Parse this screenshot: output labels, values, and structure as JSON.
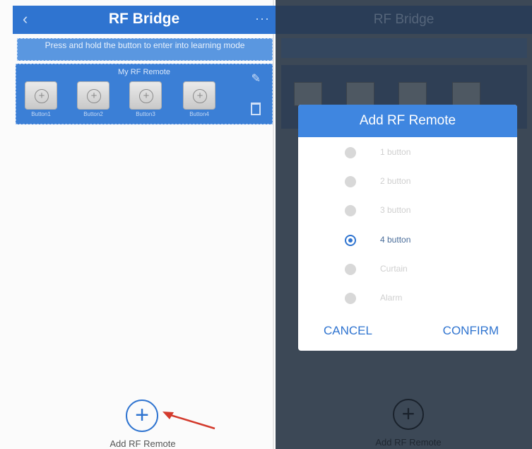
{
  "left": {
    "header": {
      "title": "RF Bridge",
      "back_glyph": "‹",
      "more_glyph": "···"
    },
    "banner": "Press and hold the button to enter into learning mode",
    "card": {
      "title": "My RF Remote",
      "buttons": [
        "Button1",
        "Button2",
        "Button3",
        "Button4"
      ],
      "edit_icon": "pencil-icon",
      "delete_icon": "trash-icon"
    },
    "add": {
      "glyph": "+",
      "label": "Add RF Remote"
    }
  },
  "right": {
    "header": {
      "title": "RF Bridge"
    },
    "add": {
      "glyph": "+",
      "label": "Add RF Remote"
    },
    "dialog": {
      "title": "Add RF Remote",
      "options": [
        "1 button",
        "2 button",
        "3 button",
        "4 button",
        "Curtain",
        "Alarm"
      ],
      "selected": "4 button",
      "cancel": "CANCEL",
      "confirm": "CONFIRM"
    }
  },
  "colors": {
    "accent": "#2f74d0",
    "dialog_header": "#3f86e0",
    "overlay": "#3c4856"
  }
}
